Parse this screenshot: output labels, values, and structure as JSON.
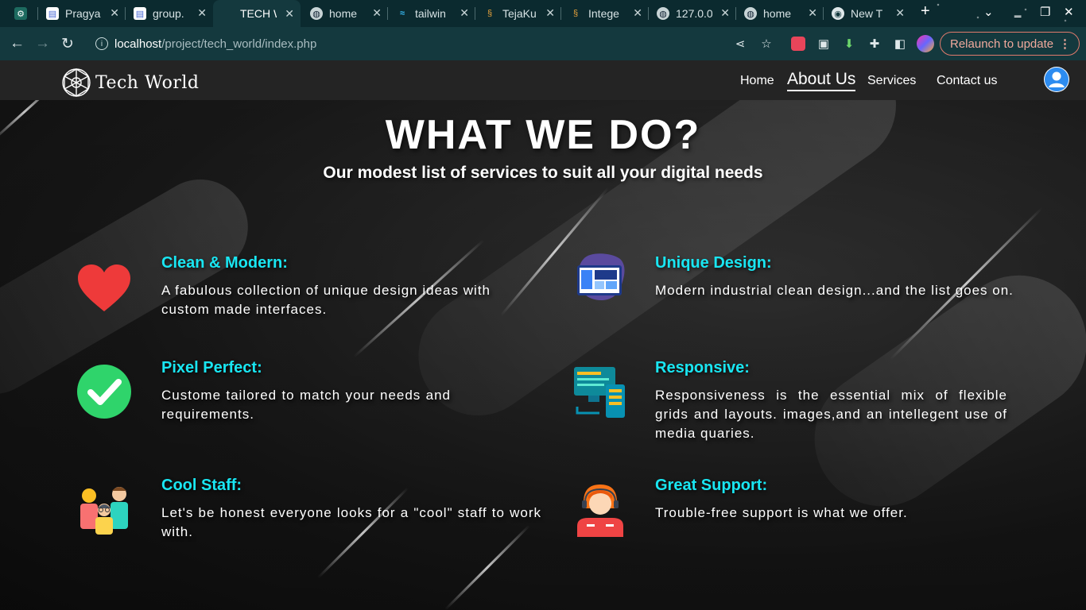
{
  "browser": {
    "tabs": [
      {
        "title": "",
        "icon": "openai-icon"
      },
      {
        "title": "Pragya",
        "icon": "document-icon"
      },
      {
        "title": "group.",
        "icon": "document-icon"
      },
      {
        "title": "TECH W",
        "icon": "none",
        "active": true
      },
      {
        "title": "home",
        "icon": "globe-icon"
      },
      {
        "title": "tailwin",
        "icon": "tailwind-icon"
      },
      {
        "title": "TejaKu",
        "icon": "codechef-icon"
      },
      {
        "title": "Intege",
        "icon": "codechef-icon"
      },
      {
        "title": "127.0.0",
        "icon": "globe-icon"
      },
      {
        "title": "home",
        "icon": "globe-icon"
      },
      {
        "title": "New T",
        "icon": "chrome-icon"
      }
    ],
    "url_host": "localhost",
    "url_path": "/project/tech_world/index.php",
    "relaunch_label": "Relaunch to update"
  },
  "site": {
    "logo_text": "Tech World",
    "nav": {
      "home": "Home",
      "about": "About Us",
      "services": "Services",
      "contact": "Contact us"
    },
    "heading": "WHAT WE DO?",
    "subheading": "Our modest list of services to suit all your digital needs",
    "services": [
      {
        "title": "Clean & Modern:",
        "text": "A fabulous collection of unique design ideas with custom made interfaces.",
        "icon": "heart-icon"
      },
      {
        "title": "Unique Design:",
        "text": "Modern industrial clean design...and the list goes on.",
        "icon": "design-board-icon"
      },
      {
        "title": "Pixel Perfect:",
        "text": "Custome tailored to match your needs and requirements.",
        "icon": "check-circle-icon"
      },
      {
        "title": "Responsive:",
        "text": "Responsiveness is the essential mix of flexible grids and layouts. images,and an intellegent use of media quaries.",
        "icon": "devices-sync-icon"
      },
      {
        "title": "Cool Staff:",
        "text": "Let's be honest everyone looks for a \"cool\" staff to work with.",
        "icon": "team-icon"
      },
      {
        "title": "Great Support:",
        "text": "Trouble-free support is what we offer.",
        "icon": "support-agent-icon"
      }
    ],
    "colors": {
      "accent": "#19e6f2",
      "nav_bg": "#242424"
    }
  }
}
